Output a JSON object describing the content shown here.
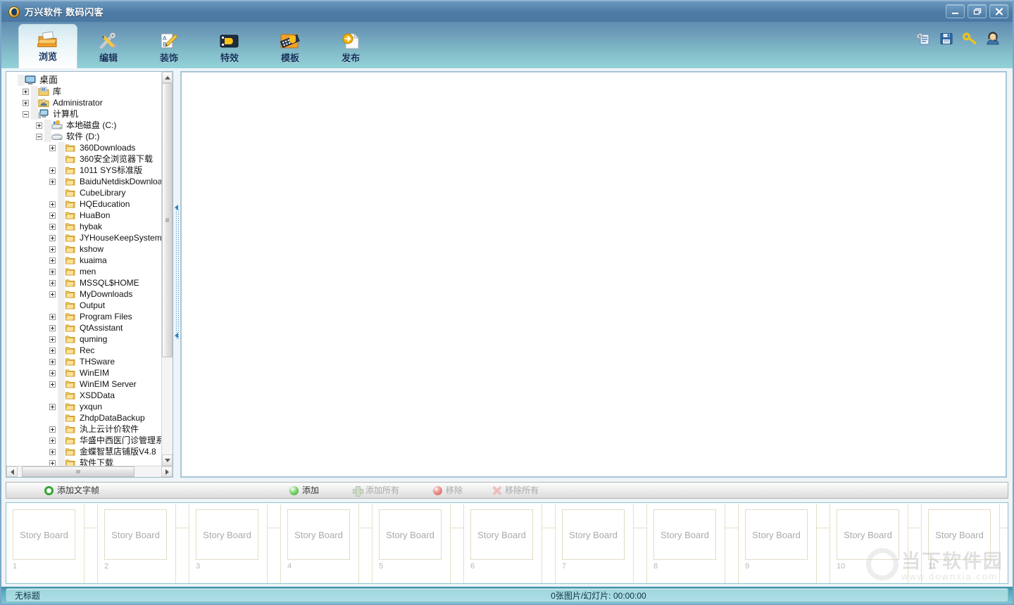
{
  "window": {
    "title": "万兴软件 数码闪客",
    "app_icon": "app-logo-icon",
    "minimize": "–",
    "restore": "❐",
    "close": "✕"
  },
  "ribbon": {
    "tabs": [
      {
        "label": "浏览",
        "icon": "open-folder-icon",
        "active": true
      },
      {
        "label": "编辑",
        "icon": "wrench-pencil-icon",
        "active": false
      },
      {
        "label": "装饰",
        "icon": "decorate-pencil-icon",
        "active": false
      },
      {
        "label": "特效",
        "icon": "film-effect-icon",
        "active": false
      },
      {
        "label": "模板",
        "icon": "template-filmstrip-icon",
        "active": false
      },
      {
        "label": "发布",
        "icon": "publish-arrow-page-icon",
        "active": false
      }
    ],
    "right_icons": [
      {
        "name": "settings-list-icon"
      },
      {
        "name": "save-floppy-icon"
      },
      {
        "name": "key-icon"
      },
      {
        "name": "support-user-icon"
      }
    ]
  },
  "tree": [
    {
      "label": "桌面",
      "depth": 0,
      "expander": "none",
      "icon": "desktop-icon"
    },
    {
      "label": "库",
      "depth": 1,
      "expander": "plus",
      "icon": "library-icon"
    },
    {
      "label": "Administrator",
      "depth": 1,
      "expander": "plus",
      "icon": "user-icon"
    },
    {
      "label": "计算机",
      "depth": 1,
      "expander": "minus",
      "icon": "computer-icon"
    },
    {
      "label": "本地磁盘 (C:)",
      "depth": 2,
      "expander": "plus",
      "icon": "system-drive-icon"
    },
    {
      "label": "软件 (D:)",
      "depth": 2,
      "expander": "minus",
      "icon": "drive-icon"
    },
    {
      "label": "360Downloads",
      "depth": 3,
      "expander": "plus",
      "icon": "folder-icon"
    },
    {
      "label": "360安全浏览器下载",
      "depth": 3,
      "expander": "none",
      "icon": "folder-icon"
    },
    {
      "label": "1011 SYS标准版",
      "depth": 3,
      "expander": "plus",
      "icon": "folder-icon"
    },
    {
      "label": "BaiduNetdiskDownload",
      "depth": 3,
      "expander": "plus",
      "icon": "folder-icon"
    },
    {
      "label": "CubeLibrary",
      "depth": 3,
      "expander": "none",
      "icon": "folder-icon"
    },
    {
      "label": "HQEducation",
      "depth": 3,
      "expander": "plus",
      "icon": "folder-icon"
    },
    {
      "label": "HuaBon",
      "depth": 3,
      "expander": "plus",
      "icon": "folder-icon"
    },
    {
      "label": "hybak",
      "depth": 3,
      "expander": "plus",
      "icon": "folder-icon"
    },
    {
      "label": "JYHouseKeepSystem",
      "depth": 3,
      "expander": "plus",
      "icon": "folder-icon"
    },
    {
      "label": "kshow",
      "depth": 3,
      "expander": "plus",
      "icon": "folder-icon"
    },
    {
      "label": "kuaima",
      "depth": 3,
      "expander": "plus",
      "icon": "folder-icon"
    },
    {
      "label": "men",
      "depth": 3,
      "expander": "plus",
      "icon": "folder-icon"
    },
    {
      "label": "MSSQL$HOME",
      "depth": 3,
      "expander": "plus",
      "icon": "folder-icon"
    },
    {
      "label": "MyDownloads",
      "depth": 3,
      "expander": "plus",
      "icon": "folder-icon"
    },
    {
      "label": "Output",
      "depth": 3,
      "expander": "none",
      "icon": "folder-icon"
    },
    {
      "label": "Program Files",
      "depth": 3,
      "expander": "plus",
      "icon": "folder-icon"
    },
    {
      "label": "QtAssistant",
      "depth": 3,
      "expander": "plus",
      "icon": "folder-icon"
    },
    {
      "label": "quming",
      "depth": 3,
      "expander": "plus",
      "icon": "folder-icon"
    },
    {
      "label": "Rec",
      "depth": 3,
      "expander": "plus",
      "icon": "folder-icon"
    },
    {
      "label": "THSware",
      "depth": 3,
      "expander": "plus",
      "icon": "folder-icon"
    },
    {
      "label": "WinEIM",
      "depth": 3,
      "expander": "plus",
      "icon": "folder-icon"
    },
    {
      "label": "WinEIM Server",
      "depth": 3,
      "expander": "plus",
      "icon": "folder-icon"
    },
    {
      "label": "XSDData",
      "depth": 3,
      "expander": "none",
      "icon": "folder-icon"
    },
    {
      "label": "yxqun",
      "depth": 3,
      "expander": "plus",
      "icon": "folder-icon"
    },
    {
      "label": "ZhdpDataBackup",
      "depth": 3,
      "expander": "none",
      "icon": "folder-icon"
    },
    {
      "label": "汍上云计价软件",
      "depth": 3,
      "expander": "plus",
      "icon": "folder-icon"
    },
    {
      "label": "华盛中西医门诊管理系统",
      "depth": 3,
      "expander": "plus",
      "icon": "folder-icon"
    },
    {
      "label": "金蝶智慧店铺版V4.8",
      "depth": 3,
      "expander": "plus",
      "icon": "folder-icon"
    },
    {
      "label": "软件下载",
      "depth": 3,
      "expander": "plus",
      "icon": "folder-icon"
    }
  ],
  "actionbar": {
    "add_text_frame": {
      "label": "添加文字帧",
      "icon": "green-ring-icon",
      "enabled": true
    },
    "add": {
      "label": "添加",
      "icon": "add-circle-icon",
      "enabled": true
    },
    "add_all": {
      "label": "添加所有",
      "icon": "add-plus-icon",
      "enabled": false
    },
    "remove": {
      "label": "移除",
      "icon": "remove-circle-icon",
      "enabled": false
    },
    "remove_all": {
      "label": "移除所有",
      "icon": "remove-x-icon",
      "enabled": false
    }
  },
  "storyboard": {
    "placeholder": "Story Board",
    "cells": [
      {
        "num": "1"
      },
      {
        "num": "2"
      },
      {
        "num": "3"
      },
      {
        "num": "4"
      },
      {
        "num": "5"
      },
      {
        "num": "6"
      },
      {
        "num": "7"
      },
      {
        "num": "8"
      },
      {
        "num": "9"
      },
      {
        "num": "10"
      },
      {
        "num": "11"
      }
    ]
  },
  "watermark": {
    "cn": "当下软件园",
    "en": "www.downxia.com"
  },
  "statusbar": {
    "left": "无标题",
    "right": "0张图片/幻灯片: 00:00:00"
  },
  "colors": {
    "titlebar": "#4d7ba4",
    "ribbon_top": "#5f8cb2",
    "ribbon_bottom": "#93d2d8",
    "status_bar": "#7fc9d4",
    "panel_border": "#9bb8ca",
    "preview_border": "#a8c6d6",
    "storyboard_border": "#8fc3cf"
  }
}
